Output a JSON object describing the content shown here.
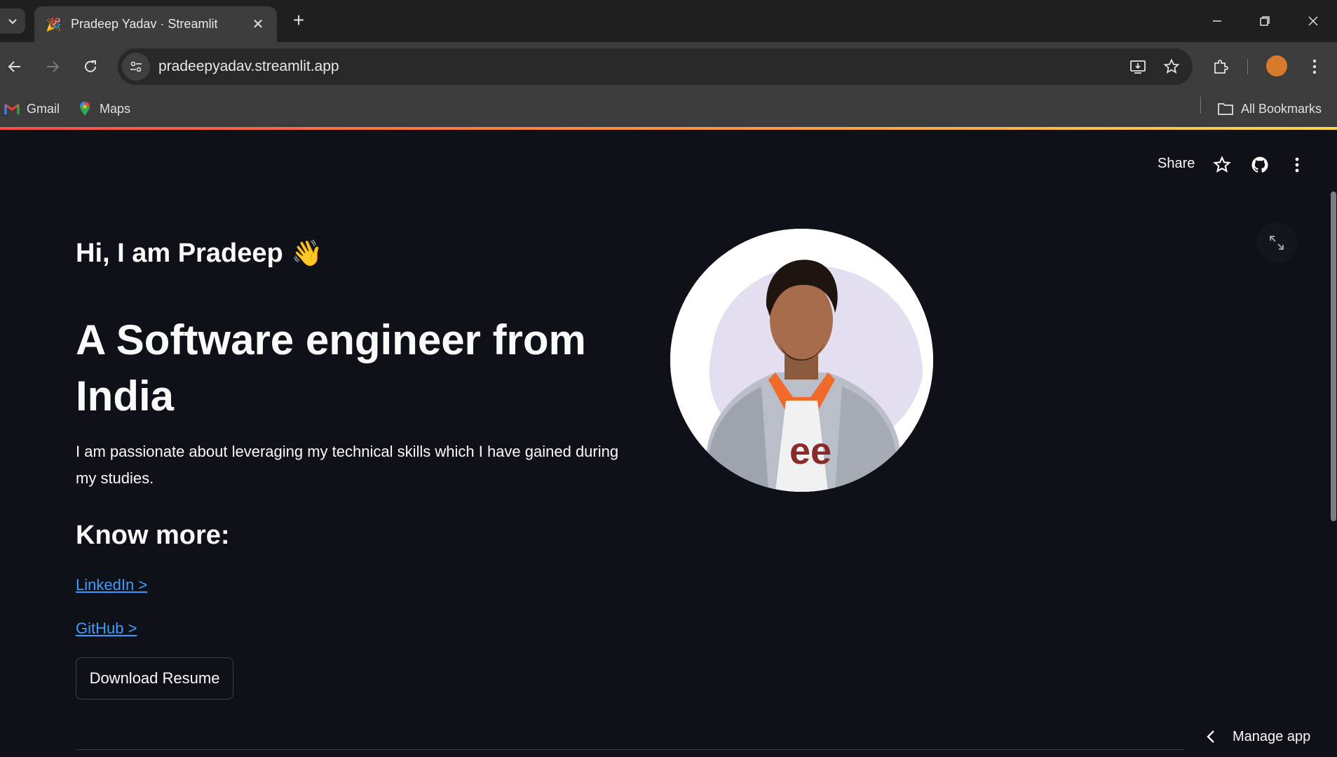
{
  "browser": {
    "tab_title": "Pradeep Yadav · Streamlit",
    "tab_favicon": "🎉",
    "url": "pradeepyadav.streamlit.app",
    "bookmarks": [
      {
        "label": "Gmail",
        "icon": "gmail-icon"
      },
      {
        "label": "Maps",
        "icon": "maps-icon"
      }
    ],
    "all_bookmarks_label": "All Bookmarks",
    "profile_color": "#d97a2a"
  },
  "app_header": {
    "share_label": "Share"
  },
  "content": {
    "greeting": "Hi, I am Pradeep",
    "greeting_emoji": "👋",
    "headline": "A Software engineer from India",
    "intro": "I am passionate about leveraging my technical skills which I have gained during my studies.",
    "know_more_heading": "Know more:",
    "links": [
      {
        "label": "LinkedIn >"
      },
      {
        "label": "GitHub >"
      }
    ],
    "download_button": "Download Resume"
  },
  "footer": {
    "manage_app_label": "Manage app"
  },
  "colors": {
    "background": "#0e1117",
    "link": "#3f9bff",
    "accent_gradient": [
      "#ff4b4b",
      "#ff8a3c",
      "#ffd84a"
    ]
  }
}
